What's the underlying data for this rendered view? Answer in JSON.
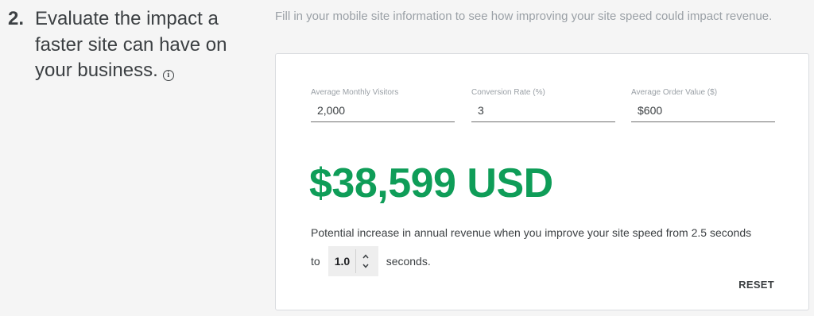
{
  "step": {
    "number": "2.",
    "heading": "Evaluate the impact a faster site can have on your business.",
    "info_icon": "info-icon"
  },
  "hint": "Fill in your mobile site information to see how improving your site speed could impact revenue.",
  "form": {
    "visitors": {
      "label": "Average Monthly Visitors",
      "value": "2,000"
    },
    "conversion": {
      "label": "Conversion Rate (%)",
      "value": "3"
    },
    "order_value": {
      "label": "Average Order Value ($)",
      "value": "$600"
    }
  },
  "result": {
    "amount": "$38,599 USD",
    "description": "Potential increase in annual revenue when you improve your site speed from 2.5 seconds",
    "to_label": "to",
    "speed_value": "1.0",
    "seconds_label": "seconds.",
    "up_icon": "chevron-up-icon",
    "down_icon": "chevron-down-icon"
  },
  "reset_label": "RESET",
  "colors": {
    "accent": "#0f9d58",
    "hint": "#9aa0a6",
    "text": "#3c4043"
  }
}
